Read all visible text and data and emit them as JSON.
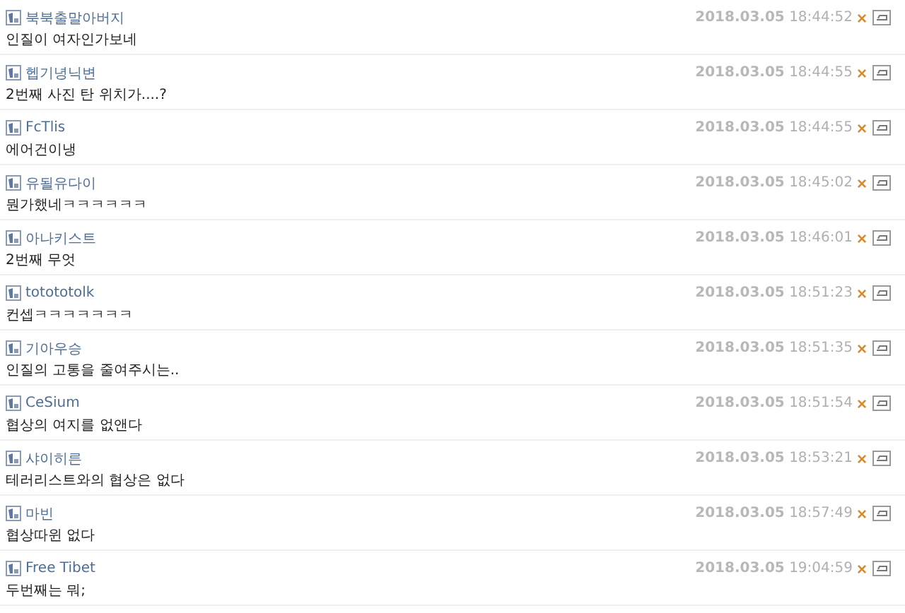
{
  "comments": [
    {
      "author": "북북출말아버지",
      "date": "2018.03.05",
      "time": "18:44:52",
      "delete": "×",
      "text": "인질이 여자인가보네"
    },
    {
      "author": "헵기녕닉변",
      "date": "2018.03.05",
      "time": "18:44:55",
      "delete": "×",
      "text": "2번째 사진 탄 위치가....?"
    },
    {
      "author": "FcTlis",
      "date": "2018.03.05",
      "time": "18:44:55",
      "delete": "×",
      "text": "에어건이냉"
    },
    {
      "author": "유될유다이",
      "date": "2018.03.05",
      "time": "18:45:02",
      "delete": "×",
      "text": "뭔가했네ㅋㅋㅋㅋㅋㅋ"
    },
    {
      "author": "아나키스트",
      "date": "2018.03.05",
      "time": "18:46:01",
      "delete": "×",
      "text": "2번째 무엇"
    },
    {
      "author": "totototolk",
      "date": "2018.03.05",
      "time": "18:51:23",
      "delete": "×",
      "text": "컨셉ㅋㅋㅋㅋㅋㅋㅋ"
    },
    {
      "author": "기아우승",
      "date": "2018.03.05",
      "time": "18:51:35",
      "delete": "×",
      "text": "인질의 고통을 줄여주시는.."
    },
    {
      "author": "CeSium",
      "date": "2018.03.05",
      "time": "18:51:54",
      "delete": "×",
      "text": "협상의 여지를 없앤다"
    },
    {
      "author": "샤이히른",
      "date": "2018.03.05",
      "time": "18:53:21",
      "delete": "×",
      "text": "테러리스트와의 협상은 없다"
    },
    {
      "author": "마빈",
      "date": "2018.03.05",
      "time": "18:57:49",
      "delete": "×",
      "text": "협상따윈 없다"
    },
    {
      "author": "Free Tibet",
      "date": "2018.03.05",
      "time": "19:04:59",
      "delete": "×",
      "text": "두번째는 뭐;"
    }
  ]
}
